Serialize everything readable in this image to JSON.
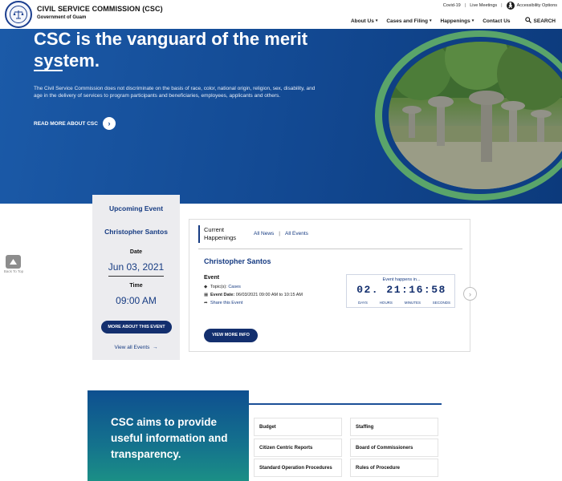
{
  "header": {
    "org_title": "CIVIL SERVICE COMMISSION (CSC)",
    "org_subtitle": "Government of Guam",
    "util_links": [
      "Covid-19",
      "Live Meetings",
      "Accessibility Options"
    ],
    "nav": [
      {
        "label": "About Us",
        "has_menu": true
      },
      {
        "label": "Cases and Filing",
        "has_menu": true
      },
      {
        "label": "Happenings",
        "has_menu": true
      },
      {
        "label": "Contact Us",
        "has_menu": false
      }
    ],
    "search_label": "SEARCH"
  },
  "hero": {
    "title": "CSC is the vanguard of the merit system.",
    "body": "The Civil Service Commission does not discriminate on the basis of race, color, national origin, religion, sex, disability, and age in the delivery of services to program participants and beneficiaries, employees, applicants and others.",
    "cta": "READ MORE ABOUT CSC"
  },
  "upcoming": {
    "title": "Upcoming Event",
    "name": "Christopher Santos",
    "date_label": "Date",
    "date": "Jun 03, 2021",
    "time_label": "Time",
    "time": "09:00 AM",
    "button": "MORE ABOUT THIS EVENT",
    "view_all": "View all Events"
  },
  "back_to_top": "Back To Top",
  "happenings": {
    "heading": "Current Happenings",
    "tabs": [
      "All News",
      "All Events"
    ],
    "event_name": "Christopher Santos",
    "event_label": "Event",
    "topics_label": "Topic(s):",
    "topics_value": "Cases",
    "date_label": "Event Date:",
    "date_value": "06/03/2021 09:00 AM to 10:15 AM",
    "share": "Share this Event",
    "button": "VIEW MORE INFO",
    "countdown": {
      "label": "Event happens in...",
      "value": "02. 21:16:58",
      "units": [
        "DAYS",
        "HOURS",
        "MINUTES",
        "SECONDS"
      ]
    }
  },
  "aims": {
    "text": "CSC aims to provide useful information and transparency.",
    "links": [
      "Budget",
      "Staffing",
      "Citizen Centric Reports",
      "Board of Commissioners",
      "Standard Operation Procedures",
      "Rules of Procedure"
    ]
  },
  "colors": {
    "brand_navy": "#132f6e",
    "hero_blue": "#124891",
    "ring_green": "#5aa46a",
    "panel_gray": "#ececef"
  }
}
